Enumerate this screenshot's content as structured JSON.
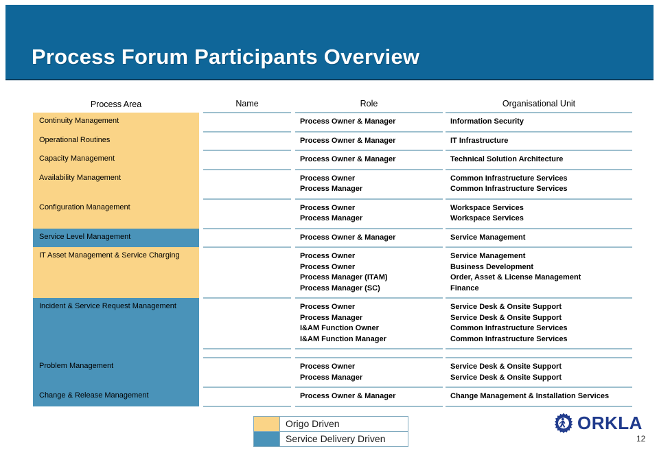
{
  "slide": {
    "title": "Process Forum Participants Overview",
    "page_number": "12"
  },
  "colors": {
    "banner_blue": "#0F6699",
    "origo_orange": "#FAD487",
    "service_blue": "#4A93B9",
    "rule_blue": "#9DBFCE",
    "logo_blue": "#1F3A8C"
  },
  "table": {
    "headers": {
      "process_area": "Process Area",
      "name": "Name",
      "role": "Role",
      "org_unit": "Organisational Unit"
    },
    "rows": [
      {
        "area": "Continuity Management",
        "category": "origo",
        "name": "",
        "roles": [
          "Process Owner & Manager"
        ],
        "orgs": [
          "Information Security"
        ]
      },
      {
        "area": "Operational Routines",
        "category": "origo",
        "name": "",
        "roles": [
          "Process Owner & Manager"
        ],
        "orgs": [
          "IT Infrastructure"
        ]
      },
      {
        "area": "Capacity Management",
        "category": "origo",
        "name": "",
        "roles": [
          "Process Owner & Manager"
        ],
        "orgs": [
          "Technical Solution Architecture"
        ]
      },
      {
        "area": "Availability Management",
        "category": "origo",
        "name": "",
        "roles": [
          "Process Owner",
          "Process Manager"
        ],
        "orgs": [
          "Common Infrastructure Services",
          "Common Infrastructure Services"
        ]
      },
      {
        "area": "Configuration Management",
        "category": "origo",
        "name": "",
        "roles": [
          "Process Owner",
          "Process Manager"
        ],
        "orgs": [
          "Workspace Services",
          "Workspace Services"
        ]
      },
      {
        "area": "Service Level Management",
        "category": "service",
        "name": "",
        "roles": [
          "Process Owner & Manager"
        ],
        "orgs": [
          "Service Management"
        ]
      },
      {
        "area": "IT Asset Management & Service Charging",
        "category": "origo",
        "name": "",
        "roles": [
          "Process Owner",
          "Process Owner",
          "Process Manager (ITAM)",
          "Process Manager (SC)"
        ],
        "orgs": [
          "Service Management",
          "Business Development",
          "Order, Asset & License Management",
          "Finance"
        ]
      },
      {
        "area": "Incident & Service Request Management",
        "category": "service",
        "name": "",
        "roles": [
          "Process Owner",
          "Process Manager",
          "I&AM Function Owner",
          "I&AM Function Manager"
        ],
        "orgs": [
          "Service Desk & Onsite Support",
          "Service Desk & Onsite Support",
          "Common Infrastructure Services",
          "Common Infrastructure Services"
        ]
      },
      {
        "area": "Problem Management",
        "category": "service",
        "name": "",
        "roles": [
          "Process Owner",
          "Process Manager"
        ],
        "orgs": [
          "Service Desk & Onsite Support",
          "Service Desk & Onsite Support"
        ]
      },
      {
        "area": "Change & Release Management",
        "category": "service",
        "name": "",
        "roles": [
          "Process Owner & Manager"
        ],
        "orgs": [
          "Change Management & Installation Services"
        ]
      }
    ]
  },
  "legend": {
    "items": [
      {
        "label": "Origo Driven",
        "category": "origo"
      },
      {
        "label": "Service Delivery Driven",
        "category": "service"
      }
    ]
  },
  "logo": {
    "text": "ORKLA",
    "mark": "gear-figure-icon"
  }
}
